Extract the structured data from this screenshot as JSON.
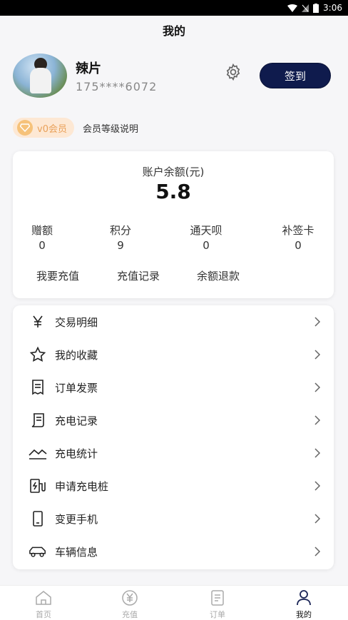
{
  "status_bar": {
    "time": "3:06"
  },
  "header": {
    "title": "我的"
  },
  "profile": {
    "name": "辣片",
    "phone": "175****6072",
    "checkin_label": "签到"
  },
  "member": {
    "badge_label": "v0会员",
    "link_label": "会员等级说明"
  },
  "balance": {
    "label": "账户余额(元)",
    "value": "5.8",
    "stats": [
      {
        "label": "赠额",
        "value": "0"
      },
      {
        "label": "积分",
        "value": "9"
      },
      {
        "label": "通天呗",
        "value": "0"
      },
      {
        "label": "补签卡",
        "value": "0"
      }
    ],
    "actions": [
      "我要充值",
      "充值记录",
      "余额退款"
    ]
  },
  "menu": [
    {
      "label": "交易明细",
      "icon": "yen-icon"
    },
    {
      "label": "我的收藏",
      "icon": "star-icon"
    },
    {
      "label": "订单发票",
      "icon": "receipt-icon"
    },
    {
      "label": "充电记录",
      "icon": "document-icon"
    },
    {
      "label": "充电统计",
      "icon": "chart-icon"
    },
    {
      "label": "申请充电桩",
      "icon": "charger-icon"
    },
    {
      "label": "变更手机",
      "icon": "phone-icon"
    },
    {
      "label": "车辆信息",
      "icon": "car-icon"
    }
  ],
  "tabs": [
    {
      "label": "首页",
      "icon": "home-icon"
    },
    {
      "label": "充值",
      "icon": "recharge-icon"
    },
    {
      "label": "订单",
      "icon": "orders-icon"
    },
    {
      "label": "我的",
      "icon": "user-icon",
      "active": true
    }
  ]
}
